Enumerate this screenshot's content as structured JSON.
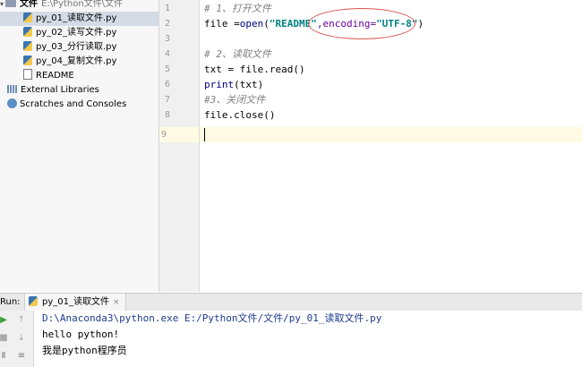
{
  "project": {
    "root": {
      "label": "文件",
      "path": "E:\\Python文件\\文件"
    },
    "files": [
      {
        "label": "py_01_读取文件.py"
      },
      {
        "label": "py_02_读写文件.py"
      },
      {
        "label": "py_03_分行读取.py"
      },
      {
        "label": "py_04_复制文件.py"
      },
      {
        "label": "README"
      }
    ],
    "external_libraries": "External Libraries",
    "scratches": "Scratches and Consoles"
  },
  "editor": {
    "line_numbers": [
      "1",
      "2",
      "3",
      "4",
      "5",
      "6",
      "7",
      "8",
      "9"
    ],
    "lines": {
      "l1": "# 1、打开文件",
      "l2_a": "file =",
      "l2_b": "open",
      "l2_c": "(",
      "l2_d": "\"README\"",
      "l2_e": ",encoding=",
      "l2_f": "\"UTF-8\"",
      "l2_g": ")",
      "l4": "# 2、读取文件",
      "l5": "txt = file.read()",
      "l6_a": "print",
      "l6_b": "(txt)",
      "l7": "#3、关闭文件",
      "l8": "file.close()"
    }
  },
  "run": {
    "label": "Run:",
    "tab_label": "py_01_读取文件",
    "tab_close": "×",
    "console_lines": [
      "D:\\Anaconda3\\python.exe E:/Python文件/文件/py_01_读取文件.py",
      "hello python!",
      "我是python程序员"
    ]
  },
  "colors": {
    "annotation_ellipse": "#d9534f",
    "current_line": "#fffae3"
  }
}
